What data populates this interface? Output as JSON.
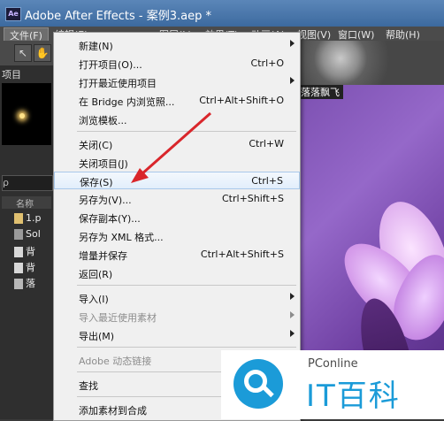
{
  "window": {
    "title": "Adobe After Effects - 案例3.aep *",
    "icon": "Ae"
  },
  "menubar": {
    "items": [
      "文件(F)",
      "编辑(E)",
      "图层(L)",
      "效果(T)",
      "动画(A)",
      "视图(V)",
      "窗口(W)",
      "帮助(H)"
    ]
  },
  "panel": {
    "tab": "项目",
    "search": "ρ",
    "column": "名称",
    "rows": [
      "1.p",
      "Sol",
      "背",
      "背",
      "落"
    ]
  },
  "viewer": {
    "title": "落落飘飞"
  },
  "file_menu": {
    "items": [
      {
        "label": "新建(N)",
        "shortcut": "",
        "submenu": true,
        "disabled": false
      },
      {
        "label": "打开项目(O)...",
        "shortcut": "Ctrl+O",
        "submenu": false,
        "disabled": false
      },
      {
        "label": "打开最近使用项目",
        "shortcut": "",
        "submenu": true,
        "disabled": false
      },
      {
        "label": "在 Bridge 内浏览照...",
        "shortcut": "Ctrl+Alt+Shift+O",
        "submenu": false,
        "disabled": false
      },
      {
        "label": "浏览模板...",
        "shortcut": "",
        "submenu": false,
        "disabled": false
      },
      {
        "label": "关闭(C)",
        "shortcut": "Ctrl+W",
        "submenu": false,
        "disabled": false
      },
      {
        "label": "关闭项目(J)",
        "shortcut": "",
        "submenu": false,
        "disabled": false
      },
      {
        "label": "保存(S)",
        "shortcut": "Ctrl+S",
        "submenu": false,
        "disabled": false,
        "highlighted": true
      },
      {
        "label": "另存为(V)...",
        "shortcut": "Ctrl+Shift+S",
        "submenu": false,
        "disabled": false
      },
      {
        "label": "保存副本(Y)...",
        "shortcut": "",
        "submenu": false,
        "disabled": false
      },
      {
        "label": "另存为 XML 格式...",
        "shortcut": "",
        "submenu": false,
        "disabled": false
      },
      {
        "label": "增量并保存",
        "shortcut": "Ctrl+Alt+Shift+S",
        "submenu": false,
        "disabled": false
      },
      {
        "label": "返回(R)",
        "shortcut": "",
        "submenu": false,
        "disabled": false
      },
      {
        "label": "导入(I)",
        "shortcut": "",
        "submenu": true,
        "disabled": false
      },
      {
        "label": "导入最近使用素材",
        "shortcut": "",
        "submenu": true,
        "disabled": true
      },
      {
        "label": "导出(M)",
        "shortcut": "",
        "submenu": true,
        "disabled": false
      },
      {
        "label": "Adobe 动态链接",
        "shortcut": "",
        "submenu": true,
        "disabled": true
      },
      {
        "label": "查找",
        "shortcut": "",
        "submenu": false,
        "disabled": false
      },
      {
        "label": "添加素材到合成",
        "shortcut": "",
        "submenu": false,
        "disabled": false
      }
    ]
  },
  "watermark": {
    "brand": "PConline",
    "text": "IT百科"
  },
  "colors": {
    "highlight": "#e2eefb",
    "arrow": "#d9262b",
    "watermark_blue": "#1b9bd8"
  }
}
